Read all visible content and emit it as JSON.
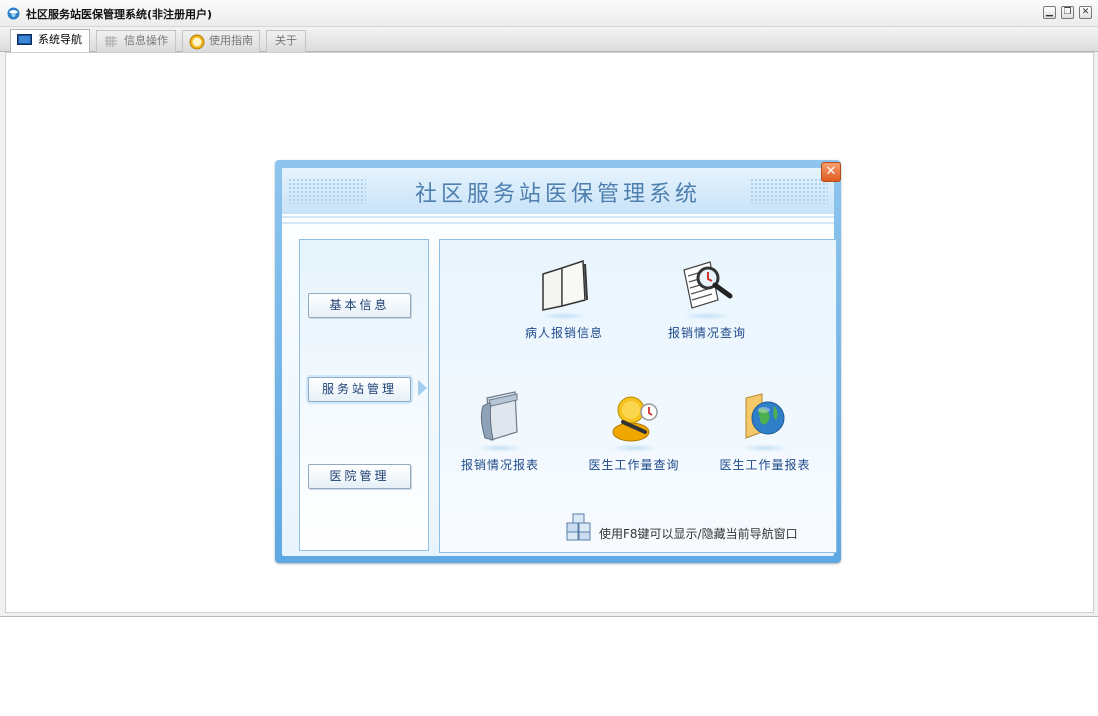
{
  "window": {
    "title": "社区服务站医保管理系统(非注册用户)"
  },
  "tabs": [
    {
      "label": "系统导航",
      "icon": "monitor-icon"
    },
    {
      "label": "信息操作",
      "icon": "grid-icon"
    },
    {
      "label": "使用指南",
      "icon": "help-globe-icon"
    },
    {
      "label": "关于",
      "icon": ""
    }
  ],
  "dialog": {
    "title": "社区服务站医保管理系统",
    "categories": [
      "基本信息",
      "服务站管理",
      "医院管理"
    ],
    "functions": [
      {
        "label": "病人报销信息",
        "icon": "open-book-icon"
      },
      {
        "label": "报销情况查询",
        "icon": "document-magnifier-icon"
      },
      {
        "label": "报销情况报表",
        "icon": "scroll-report-icon"
      },
      {
        "label": "医生工作量查询",
        "icon": "doctor-clock-icon"
      },
      {
        "label": "医生工作量报表",
        "icon": "folder-globe-icon"
      }
    ],
    "hint": "使用F8键可以显示/隐藏当前导航窗口"
  },
  "colors": {
    "dialog_border": "#5ea8e3",
    "label_text": "#1f4a8a",
    "close_button": "#e15a21"
  }
}
